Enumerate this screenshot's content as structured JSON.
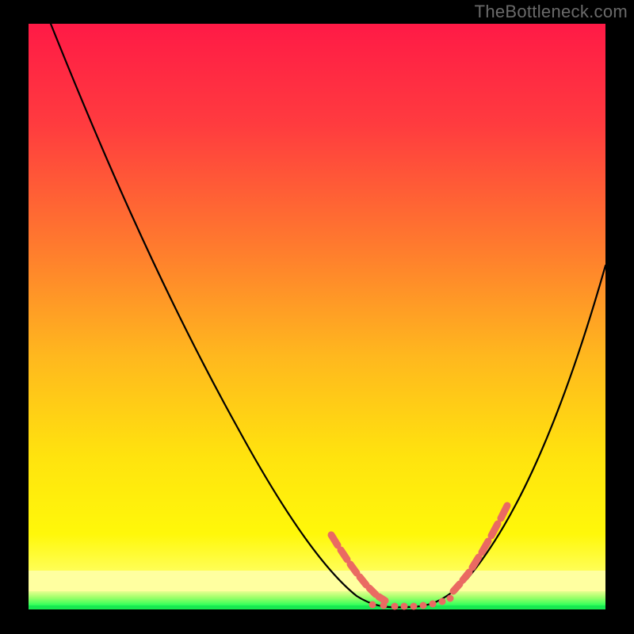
{
  "watermark": "TheBottleneck.com",
  "chart_data": {
    "type": "line",
    "title": "",
    "xlabel": "",
    "ylabel": "",
    "xlim": [
      0,
      100
    ],
    "ylim": [
      0,
      100
    ],
    "grid": false,
    "legend": false,
    "series": [
      {
        "name": "curve-left",
        "x": [
          4,
          10,
          16,
          22,
          28,
          34,
          40,
          46,
          50,
          54,
          56,
          58,
          60,
          62,
          63
        ],
        "values": [
          100,
          88,
          76,
          64,
          52,
          40,
          28,
          16,
          8,
          3,
          1.5,
          0.7,
          0.3,
          0.1,
          0
        ]
      },
      {
        "name": "curve-right",
        "x": [
          63,
          66,
          70,
          74,
          78,
          82,
          86,
          90,
          94,
          98,
          100
        ],
        "values": [
          0,
          0.4,
          2,
          6,
          12,
          19,
          27,
          35,
          44,
          54,
          59
        ]
      },
      {
        "name": "dash-left",
        "style": "segments",
        "x": [
          52.5,
          53.8,
          55.0,
          56.2,
          57.3,
          58.5,
          59.7,
          60.9,
          62.1,
          63.3
        ],
        "values": [
          4.6,
          3.4,
          2.4,
          1.7,
          1.1,
          0.7,
          0.4,
          0.25,
          0.12,
          0.05
        ]
      },
      {
        "name": "dash-right",
        "style": "segments",
        "x": [
          73.0,
          74.3,
          75.6,
          76.9,
          78.2,
          79.5,
          80.8
        ],
        "values": [
          4.7,
          6.3,
          8.1,
          10.1,
          12.4,
          14.8,
          17.3
        ]
      },
      {
        "name": "floor-dots",
        "style": "dots",
        "x": [
          54,
          56,
          58,
          59.5,
          61,
          63.5,
          65.5,
          67.5,
          69,
          71
        ],
        "values": [
          0.25,
          0.25,
          0.25,
          0.25,
          0.25,
          0.25,
          0.25,
          0.25,
          0.25,
          0.25
        ]
      }
    ],
    "background_bands": [
      {
        "y0": 40,
        "y1": 100,
        "fill": "gradient-red-to-yellow"
      },
      {
        "y0": 5,
        "y1": 40,
        "fill": "gradient-yellow"
      },
      {
        "y0": 2,
        "y1": 5,
        "fill": "pale-yellow"
      },
      {
        "y0": 0,
        "y1": 2,
        "fill": "green-band"
      },
      {
        "y0": -1,
        "y1": 0,
        "fill": "bright-green-line"
      }
    ],
    "colors": {
      "gradient_top": "#ff1a46",
      "gradient_mid": "#ffd400",
      "pale_yellow": "#ffff8a",
      "green_band_top": "#b8ff66",
      "green_band_bottom": "#36ff5e",
      "curve": "#000000",
      "dash": "#ea6a62",
      "background": "#000000"
    }
  }
}
